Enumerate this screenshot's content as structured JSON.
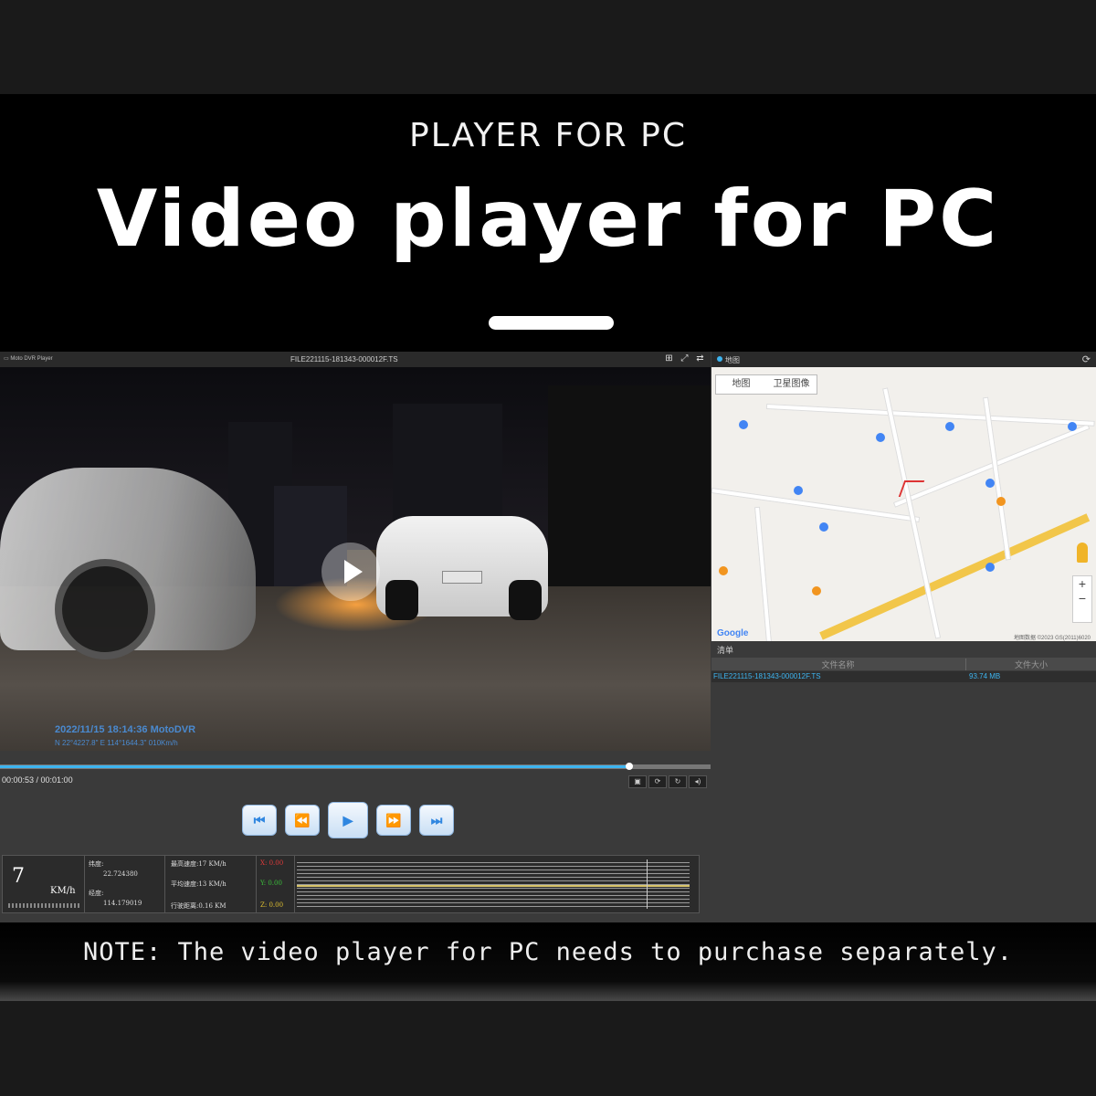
{
  "header": {
    "subtitle": "PLAYER FOR PC",
    "title": "Video player for PC"
  },
  "player": {
    "file_name": "FILE221115-181343-000012F.TS",
    "osd_datetime": "2022/11/15 18:14:36  MotoDVR",
    "osd_coords": "N 22°4227.8\"  E 114°1644.3\"    010Km/h",
    "time_display": "00:00:53 / 00:01:00",
    "progress_fraction": 0.885,
    "controls": {
      "prev_label": "⏮",
      "rewind_label": "⏪",
      "play_label": "▶",
      "forward_label": "⏩",
      "next_label": "⏭"
    },
    "stats": {
      "speed_value": "7",
      "speed_unit": "KM/h",
      "lat_label": "纬度:",
      "lat_value": "22.724380",
      "lon_label": "经度:",
      "lon_value": "114.179019",
      "max_speed": "最高速度:17 KM/h",
      "avg_speed": "平均速度:13 KM/h",
      "distance": "行驶距离:0.16 KM",
      "x_axis": "X: 0.00",
      "y_axis": "Y: 0.00",
      "z_axis": "Z: 0.00"
    }
  },
  "map_panel": {
    "title": "地图",
    "tab_map": "地图",
    "tab_satellite": "卫星图像",
    "logo": "Google",
    "credit": "地图数据 ©2023 GS(2011)6020"
  },
  "list_panel": {
    "label": "清单",
    "col_name": "文件名称",
    "col_size": "文件大小",
    "rows": [
      {
        "name": "FILE221115-181343-000012F.TS",
        "size": "93.74 MB"
      }
    ]
  },
  "note": {
    "text": "NOTE: The video player for PC needs to purchase separately."
  },
  "colors": {
    "accent": "#3db4f0",
    "road": "#f2c64a"
  }
}
